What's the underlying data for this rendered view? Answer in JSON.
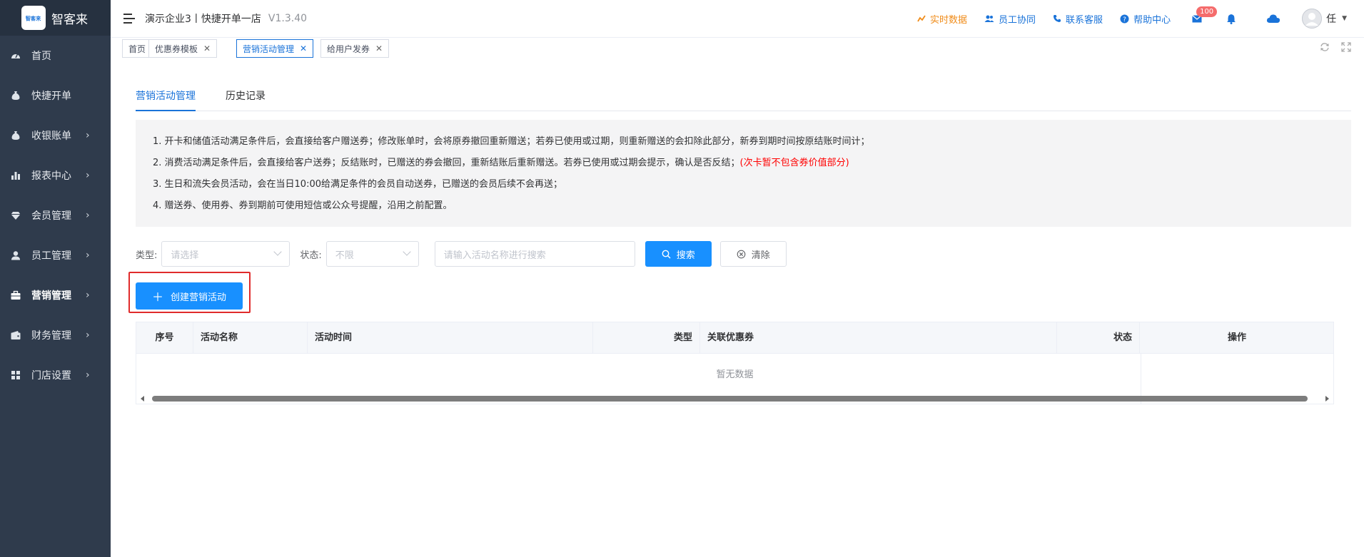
{
  "brand": {
    "logo_text": "智客来",
    "badge_text": "智客来"
  },
  "sidebar": {
    "items": [
      {
        "label": "首页",
        "icon": "dashboard-icon",
        "arrow": false
      },
      {
        "label": "快捷开单",
        "icon": "money-bag-icon",
        "arrow": false
      },
      {
        "label": "收银账单",
        "icon": "money-bag-icon",
        "arrow": true
      },
      {
        "label": "报表中心",
        "icon": "bar-chart-icon",
        "arrow": true
      },
      {
        "label": "会员管理",
        "icon": "diamond-icon",
        "arrow": true
      },
      {
        "label": "员工管理",
        "icon": "user-icon",
        "arrow": true
      },
      {
        "label": "营销管理",
        "icon": "briefcase-icon",
        "arrow": true,
        "active": true
      },
      {
        "label": "财务管理",
        "icon": "wallet-icon",
        "arrow": true
      },
      {
        "label": "门店设置",
        "icon": "grid-icon",
        "arrow": true
      }
    ]
  },
  "header": {
    "company": "演示企业3丨快捷开单一店",
    "version": "V1.3.40",
    "realtime": "实时数据",
    "collab": "员工协同",
    "service": "联系客服",
    "help": "帮助中心",
    "mail_badge": "100",
    "user_name": "任"
  },
  "tags": [
    {
      "label": "首页",
      "closable": false
    },
    {
      "label": "优惠券模板",
      "closable": true
    },
    {
      "label": "营销活动管理",
      "closable": true,
      "active": true
    },
    {
      "label": "给用户发券",
      "closable": true
    }
  ],
  "tabs": [
    {
      "label": "营销活动管理",
      "active": true
    },
    {
      "label": "历史记录",
      "active": false
    }
  ],
  "notice": {
    "line1": "1. 开卡和储值活动满足条件后，会直接给客户赠送券；修改账单时，会将原券撤回重新赠送；若券已使用或过期，则重新赠送的会扣除此部分，新券到期时间按原结账时间计；",
    "line2": "2. 消费活动满足条件后，会直接给客户送券；反结账时，已赠送的券会撤回，重新结账后重新赠送。若券已使用或过期会提示，确认是否反结；",
    "line2_red": "(次卡暂不包含券价值部分)",
    "line3": "3. 生日和流失会员活动，会在当日10:00给满足条件的会员自动送券，已赠送的会员后续不会再送；",
    "line4": "4. 赠送券、使用券、券到期前可使用短信或公众号提醒，沿用之前配置。"
  },
  "filter": {
    "type_label": "类型:",
    "type_placeholder": "请选择",
    "status_label": "状态:",
    "status_value": "不限",
    "search_placeholder": "请输入活动名称进行搜索",
    "search_btn": "搜索",
    "clear_btn": "清除"
  },
  "create_btn": "创建营销活动",
  "table": {
    "columns": [
      "序号",
      "活动名称",
      "活动时间",
      "类型",
      "关联优惠券",
      "状态",
      "操作"
    ],
    "empty": "暂无数据"
  }
}
